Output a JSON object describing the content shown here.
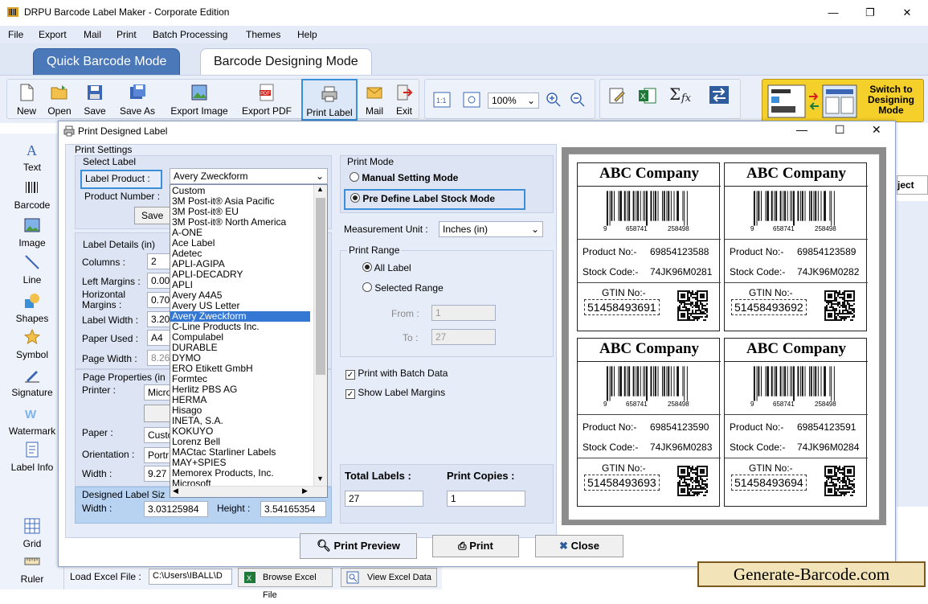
{
  "window": {
    "title": "DRPU Barcode Label Maker - Corporate Edition",
    "minimize": "—",
    "restore": "❐",
    "close": "✕"
  },
  "menu": [
    "File",
    "Export",
    "Mail",
    "Print",
    "Batch Processing",
    "Themes",
    "Help"
  ],
  "mode_tabs": {
    "quick": "Quick Barcode Mode",
    "designing": "Barcode Designing Mode"
  },
  "toolbar": {
    "buttons": [
      "New",
      "Open",
      "Save",
      "Save As",
      "Export Image",
      "Export PDF",
      "Print Label",
      "Mail",
      "Exit"
    ],
    "zoom": "100%",
    "switch": "Switch to Designing Mode"
  },
  "left_tools": [
    "Text",
    "Barcode",
    "Image",
    "Line",
    "Shapes",
    "Symbol",
    "Signature",
    "Watermark",
    "Label Info",
    "Grid",
    "Ruler"
  ],
  "bg_fragment": "ject",
  "dialog": {
    "title": "Print Designed Label",
    "print_settings": "Print Settings",
    "select_label": "Select Label",
    "label_product": "Label Product :",
    "label_product_value": "Avery Zweckform",
    "product_number": "Product Number :",
    "save_btn": "Save",
    "label_details": "Label Details (in)",
    "fields": {
      "columns": {
        "label": "Columns :",
        "value": "2"
      },
      "left_margins": {
        "label": "Left Margins :",
        "value": "0.00"
      },
      "horizontal_margins": {
        "label": "Horizontal Margins :",
        "value": "0.70"
      },
      "label_width": {
        "label": "Label Width :",
        "value": "3.20"
      },
      "paper_used": {
        "label": "Paper Used :",
        "value": "A4"
      },
      "page_width": {
        "label": "Page Width :",
        "value": "8.26"
      }
    },
    "page_properties": "Page Properties (in",
    "printer": {
      "label": "Printer :",
      "value": "Micro"
    },
    "paper": {
      "label": "Paper :",
      "value": "Custo"
    },
    "orientation": {
      "label": "Orientation :",
      "value": "Portr"
    },
    "width_pp": {
      "label": "Width :",
      "value": "9.27"
    },
    "designed_label_size": "Designed Label Siz",
    "dl_width": {
      "label": "Width :",
      "value": "3.03125984"
    },
    "dl_height": {
      "label": "Height :",
      "value": "3.54165354"
    },
    "dropdown_items": [
      "Custom",
      "3M   Post-it®   Asia Pacific",
      "3M   Post-it®   EU",
      "3M   Post-it®   North America",
      "A-ONE",
      "Ace Label",
      "Adetec",
      "APLI-AGIPA",
      "APLI-DECADRY",
      "APLI",
      "Avery A4A5",
      "Avery US Letter",
      "Avery Zweckform",
      "C-Line Products Inc.",
      "Compulabel",
      "DURABLE",
      "DYMO",
      "ERO Etikett GmbH",
      "Formtec",
      "Herlitz PBS AG",
      "HERMA",
      "Hisago",
      "INETA, S.A.",
      "KOKUYO",
      "Lorenz Bell",
      "MACtac Starliner Labels",
      "MAY+SPIES",
      "Memorex Products, Inc.",
      "Microsoft"
    ],
    "dropdown_selected_index": 12,
    "print_mode": "Print Mode",
    "manual_mode": "Manual Setting Mode",
    "predefine_mode": "Pre Define Label Stock Mode",
    "measurement_unit": {
      "label": "Measurement Unit :",
      "value": "Inches (in)"
    },
    "print_range": "Print Range",
    "all_label": "All Label",
    "selected_range": "Selected Range",
    "from": {
      "label": "From :",
      "value": "1"
    },
    "to": {
      "label": "To :",
      "value": "27"
    },
    "batch_data": "Print with Batch Data",
    "label_margins": "Show Label Margins",
    "total_labels": {
      "label": "Total Labels :",
      "value": "27"
    },
    "print_copies": {
      "label": "Print Copies :",
      "value": "1"
    },
    "print_preview_btn": "Print Preview",
    "print_btn": "Print",
    "close_btn": "Close"
  },
  "labels": [
    {
      "company": "ABC Company",
      "d1": "9",
      "d2": "658741",
      "d3": "258498",
      "product_label": "Product No:-",
      "product": "69854123588",
      "stock_label": "Stock Code:-",
      "stock": "74JK96M0281",
      "gtin_label": "GTIN No:-",
      "gtin": "51458493691"
    },
    {
      "company": "ABC Company",
      "d1": "9",
      "d2": "658741",
      "d3": "258498",
      "product_label": "Product No:-",
      "product": "69854123589",
      "stock_label": "Stock Code:-",
      "stock": "74JK96M0282",
      "gtin_label": "GTIN No:-",
      "gtin": "51458493692"
    },
    {
      "company": "ABC Company",
      "d1": "9",
      "d2": "658741",
      "d3": "258498",
      "product_label": "Product No:-",
      "product": "69854123590",
      "stock_label": "Stock Code:-",
      "stock": "74JK96M0283",
      "gtin_label": "GTIN No:-",
      "gtin": "51458493693"
    },
    {
      "company": "ABC Company",
      "d1": "9",
      "d2": "658741",
      "d3": "258498",
      "product_label": "Product No:-",
      "product": "69854123591",
      "stock_label": "Stock Code:-",
      "stock": "74JK96M0284",
      "gtin_label": "GTIN No:-",
      "gtin": "51458493694"
    }
  ],
  "bottom": {
    "load_excel": "Load Excel File :",
    "path": "C:\\Users\\IBALL\\D",
    "browse": "Browse Excel File",
    "view": "View Excel Data"
  },
  "watermark": "Generate-Barcode.com",
  "colors": {
    "accent": "#3a8fd8",
    "tab_active": "#4a78b8",
    "selected_item": "#3478d4"
  }
}
